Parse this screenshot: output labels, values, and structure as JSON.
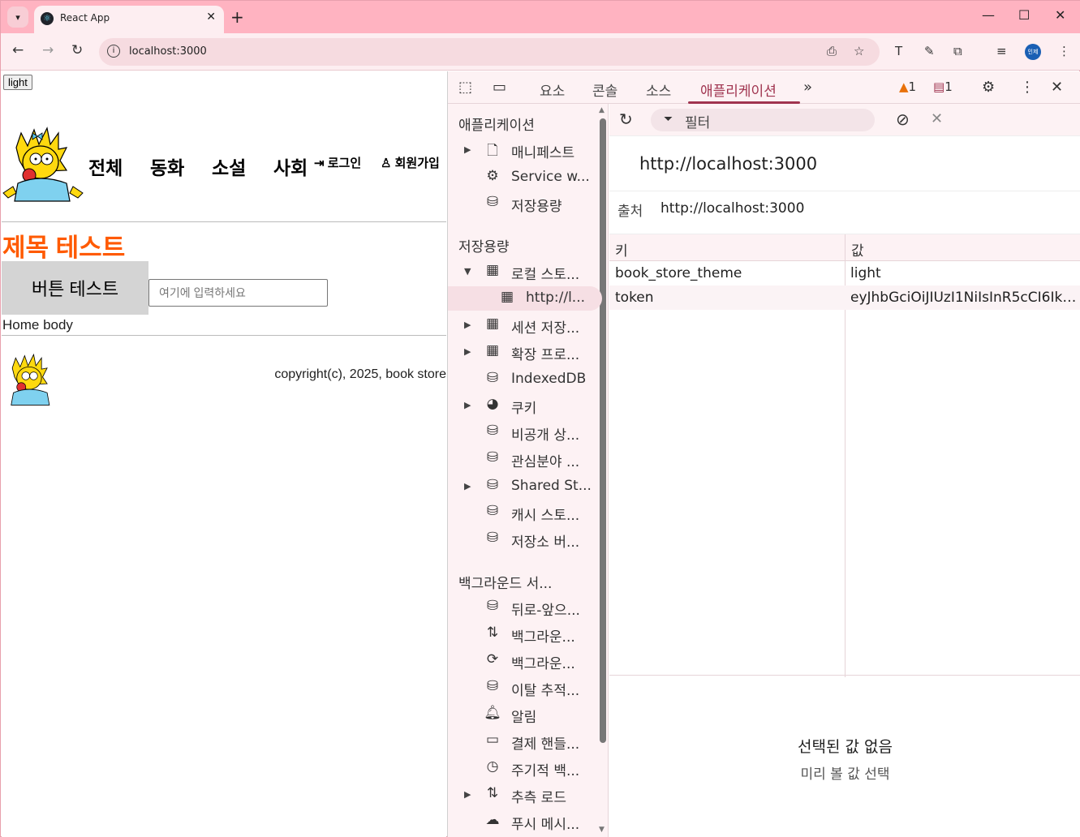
{
  "browser": {
    "tab_title": "React App",
    "url": "localhost:3000"
  },
  "page": {
    "theme_button": "light",
    "menu": [
      "전체",
      "동화",
      "소설",
      "사회"
    ],
    "login": "로그인",
    "signup": "회원가입",
    "title": "제목 테스트",
    "button": "버튼 테스트",
    "input_placeholder": "여기에 입력하세요",
    "body_text": "Home body",
    "copyright": "copyright(c), 2025, book store"
  },
  "devtools": {
    "tabs": [
      "요소",
      "콘솔",
      "소스",
      "애플리케이션"
    ],
    "active_tab": "애플리케이션",
    "warning_count": "1",
    "message_count": "1",
    "sidebar": {
      "section_app": "애플리케이션",
      "app_items": [
        "매니페스트",
        "Service w...",
        "저장용량"
      ],
      "section_storage": "저장용량",
      "storage_items": [
        "로컬 스토...",
        "http://l...",
        "세션 저장...",
        "확장 프로...",
        "IndexedDB",
        "쿠키",
        "비공개 상...",
        "관심분야 ...",
        "Shared St...",
        "캐시 스토...",
        "저장소 버..."
      ],
      "section_bg": "백그라운드 서...",
      "bg_items": [
        "뒤로-앞으...",
        "백그라운...",
        "백그라운...",
        "이탈 추적...",
        "알림",
        "결제 핸들...",
        "주기적 백...",
        "추측 로드",
        "푸시 메시..."
      ]
    },
    "filter_placeholder": "필터",
    "origin_heading": "http://localhost:3000",
    "origin_label": "출처",
    "origin_value": "http://localhost:3000",
    "table": {
      "headers": [
        "키",
        "값"
      ],
      "rows": [
        {
          "key": "book_store_theme",
          "value": "light"
        },
        {
          "key": "token",
          "value": "eyJhbGciOiJIUzI1NiIsInR5cCI6Ikp..."
        }
      ]
    },
    "empty_title": "선택된 값 없음",
    "empty_sub": "미리 볼 값 선택"
  },
  "colors": {
    "accent": "#a0344f",
    "title_orange": "#ff5a00",
    "tab_strip": "#ffb3c1"
  }
}
